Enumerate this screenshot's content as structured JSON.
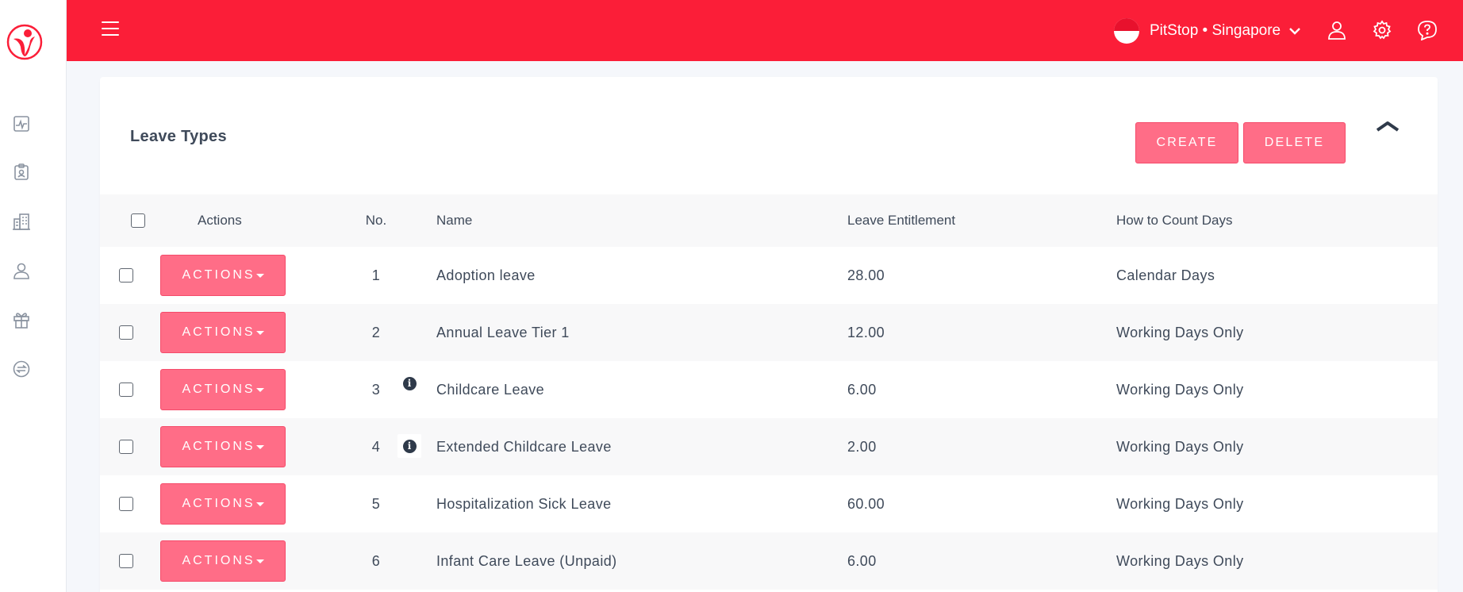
{
  "topbar": {
    "organization": "PitStop • Singapore"
  },
  "icons": {
    "sidebar": [
      "activity-icon",
      "id-badge-icon",
      "building-icon",
      "user-icon",
      "gift-icon",
      "exchange-icon"
    ],
    "topbar": [
      "user-icon",
      "gear-icon",
      "help-icon"
    ]
  },
  "colors": {
    "topbar": "#fb1e38",
    "button": "#ff6d87",
    "text": "#3f4a5a"
  },
  "page": {
    "title": "Leave Types",
    "create_label": "CREATE",
    "delete_label": "DELETE"
  },
  "table": {
    "headers": {
      "actions": "Actions",
      "no": "No.",
      "name": "Name",
      "entitlement": "Leave Entitlement",
      "count": "How to Count Days"
    },
    "action_label": "ACTIONS",
    "rows": [
      {
        "no": "1",
        "name": "Adoption leave",
        "entitlement": "28.00",
        "count": "Calendar Days"
      },
      {
        "no": "2",
        "name": "Annual Leave Tier 1",
        "entitlement": "12.00",
        "count": "Working Days Only"
      },
      {
        "no": "3",
        "name": "Childcare Leave",
        "entitlement": "6.00",
        "count": "Working Days Only"
      },
      {
        "no": "4",
        "name": "Extended Childcare Leave",
        "entitlement": "2.00",
        "count": "Working Days Only"
      },
      {
        "no": "5",
        "name": "Hospitalization Sick Leave",
        "entitlement": "60.00",
        "count": "Working Days Only"
      },
      {
        "no": "6",
        "name": "Infant Care Leave (Unpaid)",
        "entitlement": "6.00",
        "count": "Working Days Only"
      }
    ]
  }
}
